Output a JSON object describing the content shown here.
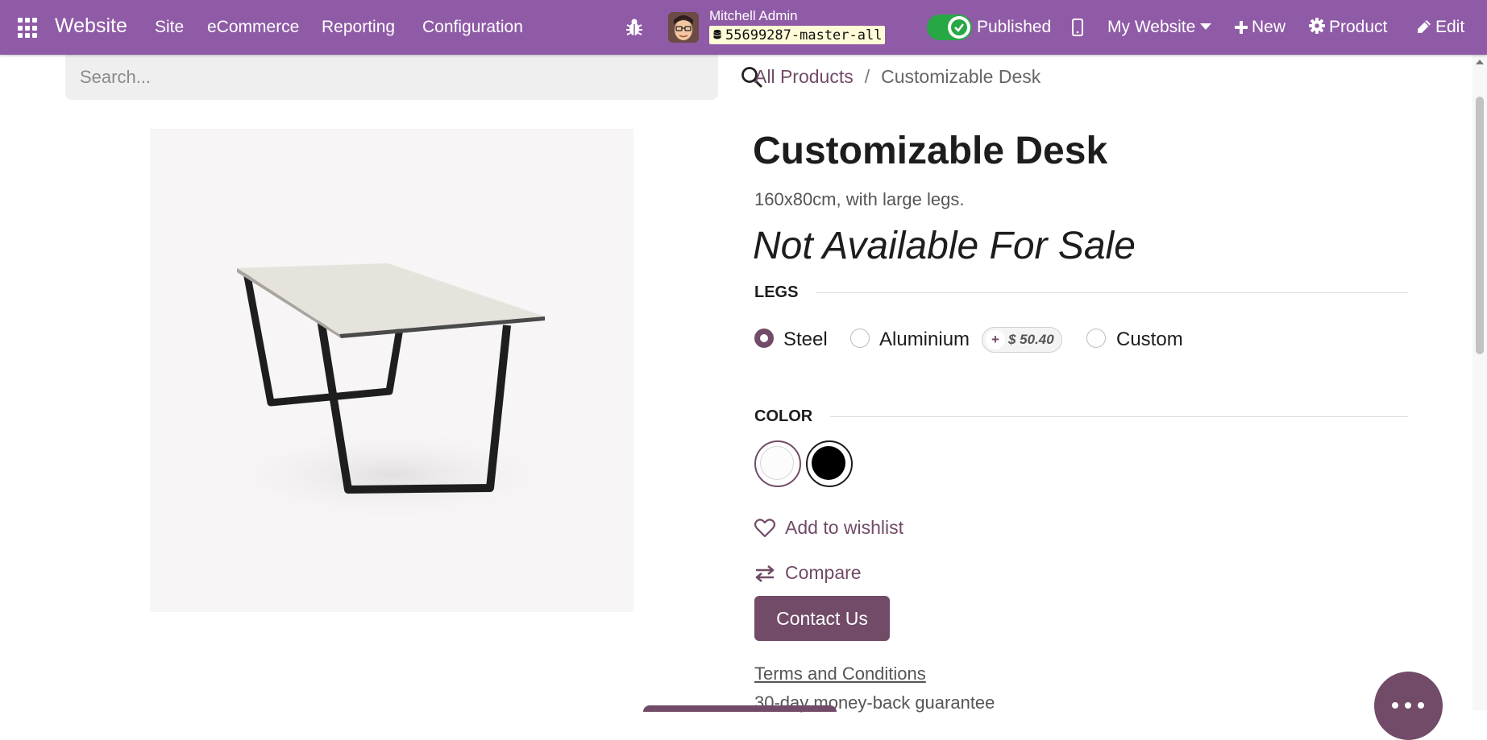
{
  "navbar": {
    "app_name": "Website",
    "menu": [
      "Site",
      "eCommerce",
      "Reporting",
      "Configuration"
    ],
    "user_name": "Mitchell Admin",
    "database": "55699287-master-all",
    "published_label": "Published",
    "website_selector": "My Website",
    "new_label": "New",
    "product_label": "Product",
    "edit_label": "Edit"
  },
  "search": {
    "placeholder": "Search..."
  },
  "breadcrumb": {
    "parent": "All Products",
    "separator": "/",
    "current": "Customizable Desk"
  },
  "product": {
    "name": "Customizable Desk",
    "description": "160x80cm, with large legs.",
    "availability": "Not Available For Sale"
  },
  "legs": {
    "label": "LEGS",
    "options": [
      {
        "name": "Steel",
        "selected": true
      },
      {
        "name": "Aluminium",
        "selected": false,
        "extra_price": "$ 50.40"
      },
      {
        "name": "Custom",
        "selected": false
      }
    ],
    "extra_sign": "+"
  },
  "color": {
    "label": "COLOR",
    "swatches": [
      {
        "name": "white",
        "color": "#ffffff",
        "selected": true
      },
      {
        "name": "black",
        "color": "#000000",
        "selected": false
      }
    ]
  },
  "actions": {
    "wishlist": "Add to wishlist",
    "compare": "Compare",
    "contact": "Contact Us"
  },
  "footer_links": {
    "terms": "Terms and Conditions",
    "guarantee": "30-day money-back guarantee"
  },
  "colors": {
    "navbar": "#8f5ba6",
    "accent": "#714b67",
    "toggle_on": "#28a745"
  }
}
